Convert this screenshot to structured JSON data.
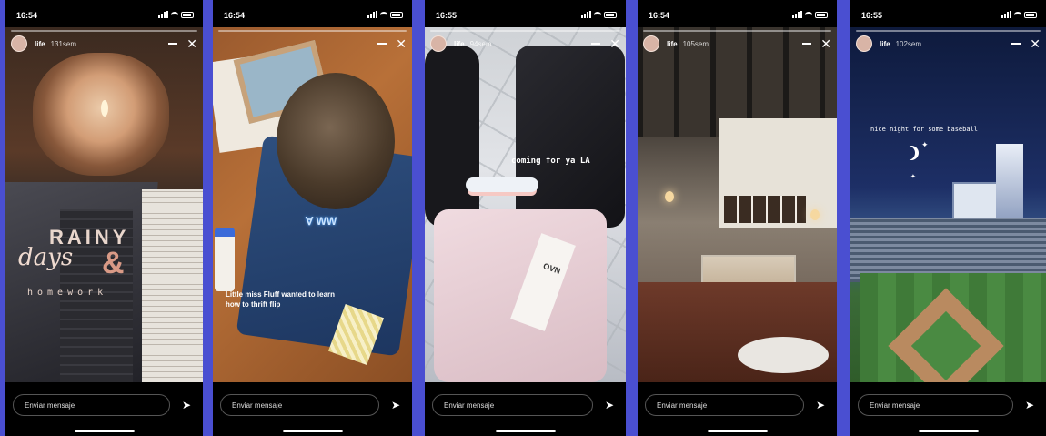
{
  "stories": [
    {
      "time": "16:54",
      "user": "life",
      "ago": "131sem",
      "message_placeholder": "Enviar mensaje",
      "stickers": {
        "big": "RAINY",
        "script": "days",
        "amp": "&",
        "sub": "homework"
      }
    },
    {
      "time": "16:54",
      "user": "life",
      "ago": "",
      "message_placeholder": "Enviar mensaje",
      "caption": "Little miss Fluff wanted to learn how to thrift flip",
      "shirt_text": "Ɐ WW"
    },
    {
      "time": "16:55",
      "user": "life",
      "ago": "94sem",
      "message_placeholder": "Enviar mensaje",
      "caption": "coming for ya LA",
      "tag_text": "OVN"
    },
    {
      "time": "16:54",
      "user": "life",
      "ago": "105sem",
      "message_placeholder": "Enviar mensaje"
    },
    {
      "time": "16:55",
      "user": "life",
      "ago": "102sem",
      "message_placeholder": "Enviar mensaje",
      "caption": "nice night for some baseball"
    }
  ],
  "colors": {
    "background": "#4a4fd1",
    "bar": "#000000"
  }
}
